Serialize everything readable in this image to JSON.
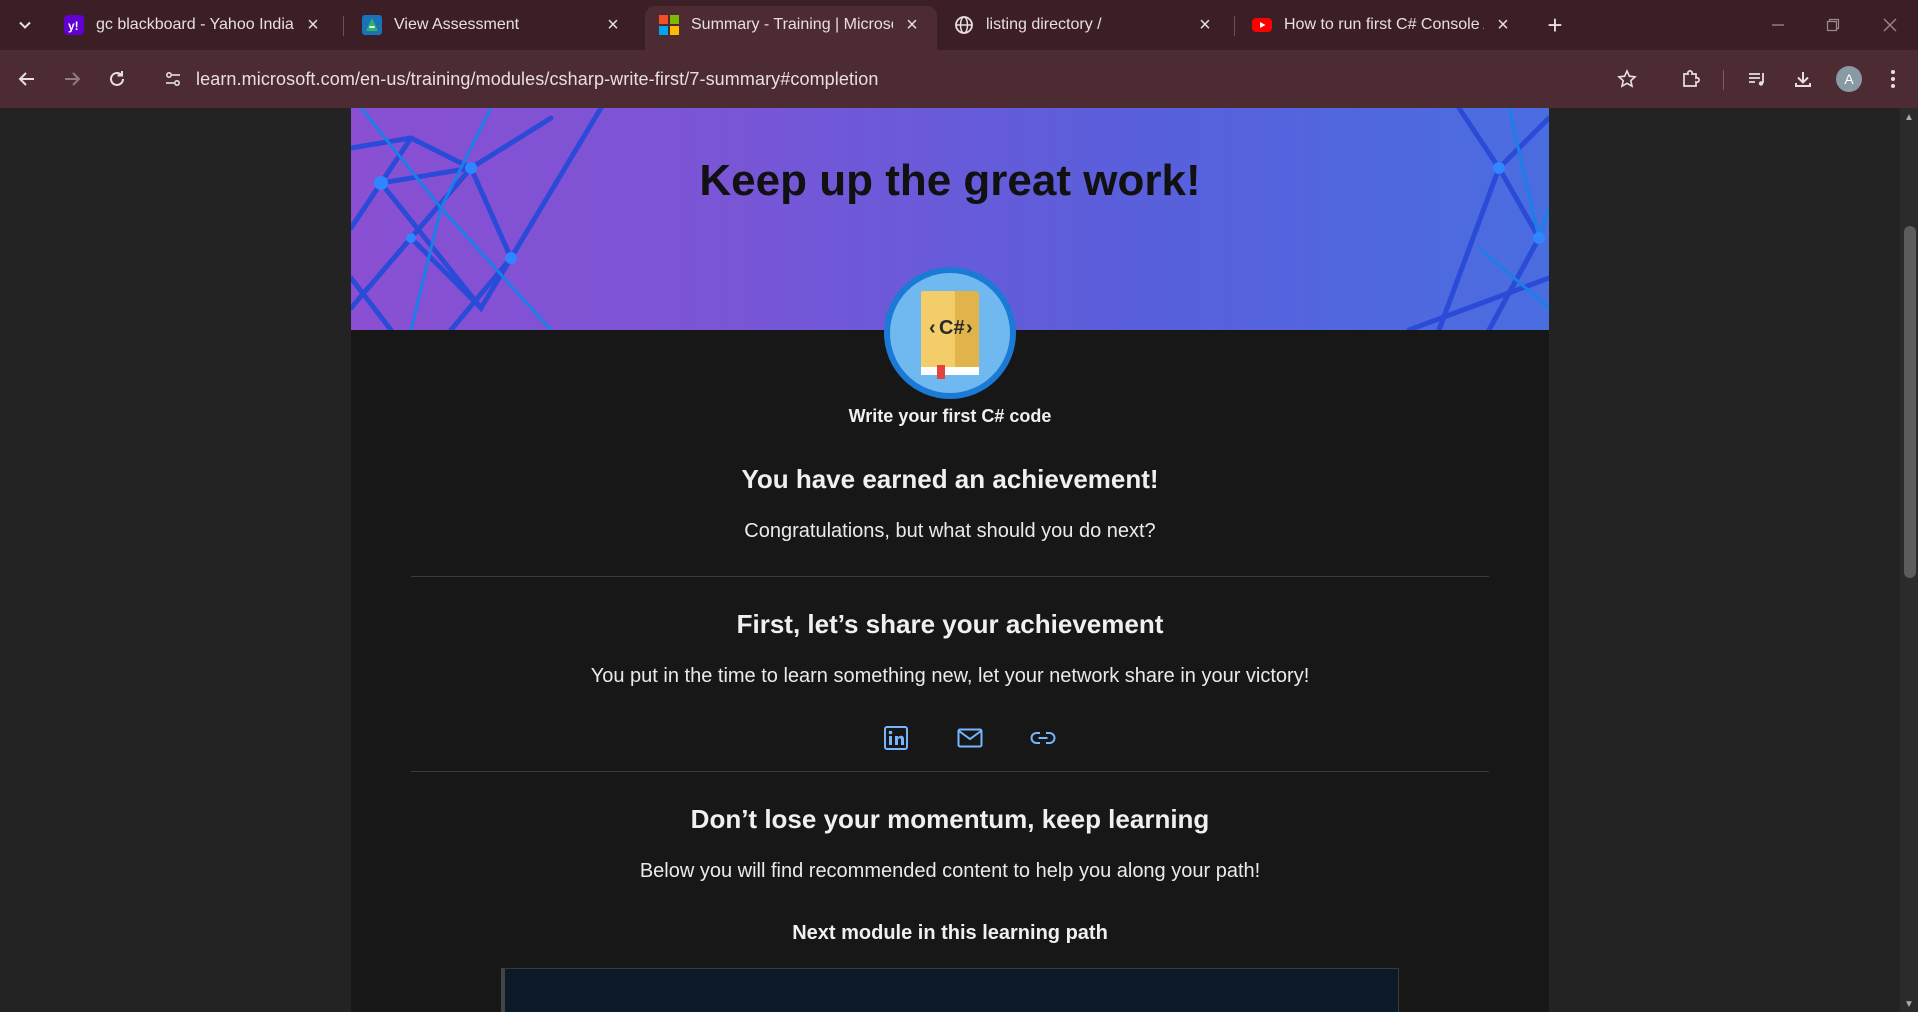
{
  "browser": {
    "tabs": [
      {
        "title": "gc blackboard - Yahoo India Se",
        "icon": "yahoo-icon"
      },
      {
        "title": "View Assessment",
        "icon": "assessment-icon"
      },
      {
        "title": "Summary - Training | Microsoft",
        "icon": "microsoft-icon",
        "active": true
      },
      {
        "title": "listing directory /",
        "icon": "globe-icon"
      },
      {
        "title": "How to run first C# Console Ap",
        "icon": "youtube-icon"
      }
    ],
    "url": "learn.microsoft.com/en-us/training/modules/csharp-write-first/7-summary#completion",
    "profile_initial": "A"
  },
  "page": {
    "hero_title": "Keep up the great work!",
    "badge_label": "C#",
    "module_name": "Write your first C# code",
    "achievement_heading": "You have earned an achievement!",
    "achievement_text": "Congratulations, but what should you do next?",
    "share_heading": "First, let’s share your achievement",
    "share_text": "You put in the time to learn something new, let your network share in your victory!",
    "momentum_heading": "Don’t lose your momentum, keep learning",
    "momentum_text": "Below you will find recommended content to help you along your path!",
    "next_module_heading": "Next module in this learning path"
  },
  "colors": {
    "tabstrip": "#3c1f26",
    "toolbar": "#4c2b33",
    "hero_start": "#8a4fd2",
    "hero_end": "#4a6de0",
    "badge_ring": "#1b7ad6",
    "share_icon": "#75b6ff"
  }
}
